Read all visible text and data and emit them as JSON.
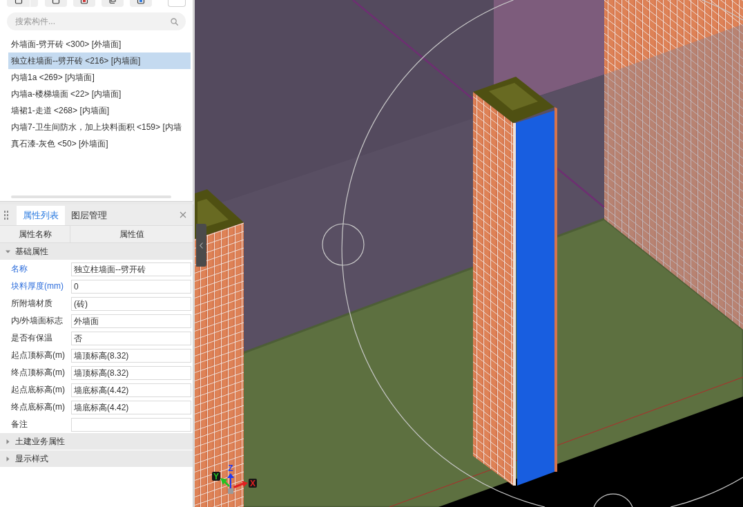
{
  "search": {
    "placeholder": "搜索构件..."
  },
  "components": [
    {
      "label": "外墙面-劈开砖 <300> [外墙面]",
      "selected": false
    },
    {
      "label": "独立柱墙面--劈开砖 <216> [内墙面]",
      "selected": true
    },
    {
      "label": "内墙1a <269> [内墙面]",
      "selected": false
    },
    {
      "label": "内墙a-楼梯墙面 <22> [内墙面]",
      "selected": false
    },
    {
      "label": "墙裙1-走道 <268> [内墙面]",
      "selected": false
    },
    {
      "label": "内墙7-卫生间防水，加上块料面积 <159> [内墙",
      "selected": false
    },
    {
      "label": "真石漆-灰色 <50> [外墙面]",
      "selected": false
    }
  ],
  "properties": {
    "tabs": [
      {
        "label": "属性列表",
        "selected": true
      },
      {
        "label": "图层管理",
        "selected": false
      }
    ],
    "columns": [
      "属性名称",
      "属性值"
    ],
    "groups": [
      {
        "label": "基础属性",
        "expanded": true,
        "rows": [
          {
            "name": "名称",
            "value": "独立柱墙面--劈开砖",
            "public": true
          },
          {
            "name": "块料厚度(mm)",
            "value": "0",
            "public": true
          },
          {
            "name": "所附墙材质",
            "value": "(砖)",
            "public": false
          },
          {
            "name": "内/外墙面标志",
            "value": "外墙面",
            "public": false
          },
          {
            "name": "是否有保温",
            "value": "否",
            "public": false
          },
          {
            "name": "起点顶标高(m)",
            "value": "墙顶标高(8.32)",
            "public": false
          },
          {
            "name": "终点顶标高(m)",
            "value": "墙顶标高(8.32)",
            "public": false
          },
          {
            "name": "起点底标高(m)",
            "value": "墙底标高(4.42)",
            "public": false
          },
          {
            "name": "终点底标高(m)",
            "value": "墙底标高(4.42)",
            "public": false
          },
          {
            "name": "备注",
            "public": false
          }
        ]
      },
      {
        "label": "土建业务属性",
        "expanded": false
      },
      {
        "label": "显示样式",
        "expanded": false
      }
    ]
  },
  "viewport": {
    "axes": [
      {
        "kind": "z",
        "label": "Z",
        "color": "#1f3cf0"
      },
      {
        "kind": "y",
        "label": "Y",
        "color": "#22c422"
      },
      {
        "kind": "x",
        "label": "X",
        "color": "#e02020"
      }
    ]
  }
}
